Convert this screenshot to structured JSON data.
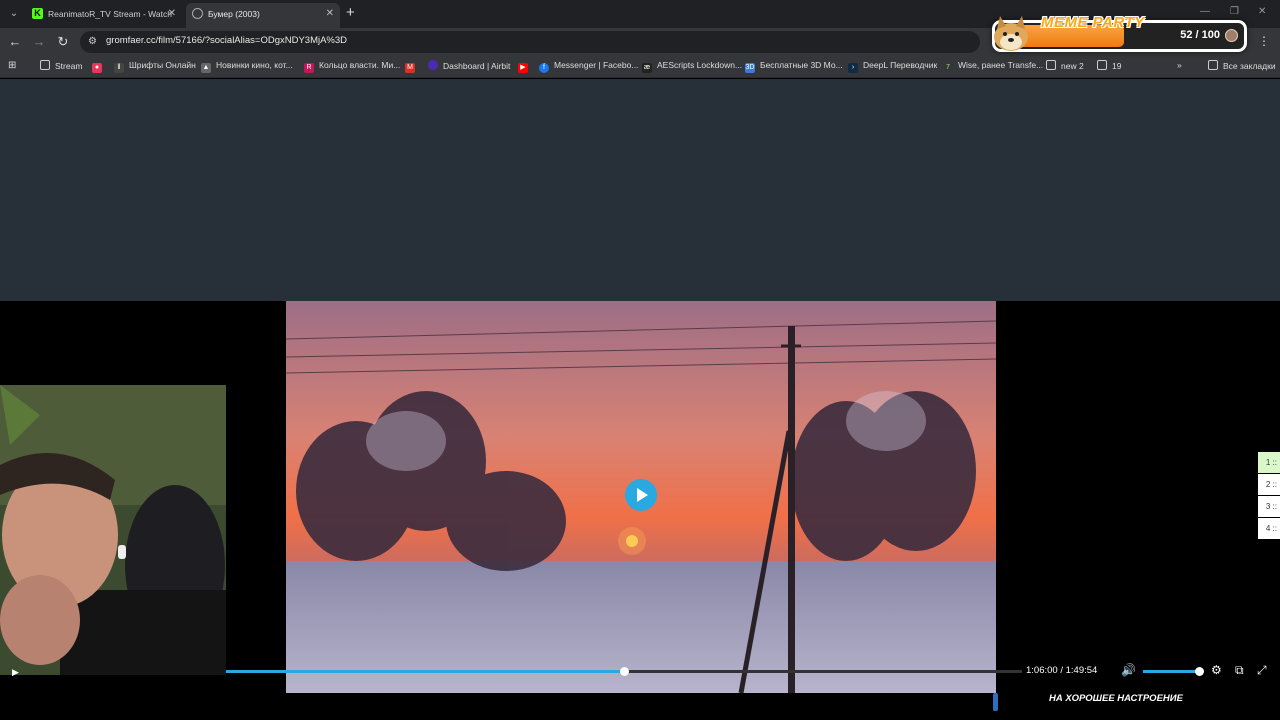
{
  "browser": {
    "tabs": [
      {
        "title": "ReanimatoR_TV Stream - Watch",
        "icon": "kick-icon",
        "active": false
      },
      {
        "title": "Бумер (2003)",
        "icon": "globe-icon",
        "active": true
      }
    ],
    "url": "gromfaer.cc/film/57166/?socialAlias=ODgxNDY3MjA%3D",
    "bookmarks": [
      {
        "label": "Stream",
        "icon": "folder-icon"
      },
      {
        "label": "",
        "icon": "live-icon"
      },
      {
        "label": "Шрифты Онлайн",
        "icon": "font-icon"
      },
      {
        "label": "Новинки кино, кот...",
        "icon": "film-icon"
      },
      {
        "label": "Кольцо власти. Ми...",
        "icon": "r-icon"
      },
      {
        "label": "",
        "icon": "gmail-icon"
      },
      {
        "label": "Dashboard | Airbit",
        "icon": "airbit-icon"
      },
      {
        "label": "",
        "icon": "youtube-icon"
      },
      {
        "label": "Messenger | Facebo...",
        "icon": "facebook-icon"
      },
      {
        "label": "AEScripts Lockdown...",
        "icon": "aescripts-icon"
      },
      {
        "label": "Бесплатные 3D Мо...",
        "icon": "3d-icon"
      },
      {
        "label": "DeepL Переводчик",
        "icon": "deepl-icon"
      },
      {
        "label": "Wise, ранее Transfe...",
        "icon": "wise-icon"
      },
      {
        "label": "new 2",
        "icon": "folder-icon"
      },
      {
        "label": "19",
        "icon": "folder-icon"
      }
    ],
    "overflow": "»",
    "all_bookmarks": "Все закладки"
  },
  "overlay": {
    "title": "MEME PARTY",
    "count": "52 / 100",
    "progress": 0.52
  },
  "player": {
    "current_time": "1:06:00",
    "separator": "/",
    "duration": "1:49:54",
    "progress": 0.5,
    "volume": 1.0
  },
  "side_tabs": [
    "1 ::",
    "2 ::",
    "3 ::",
    "4 ::"
  ],
  "ticker": "НА ХОРОШЕЕ НАСТРОЕНИЕ",
  "colors": {
    "accent": "#2aa8e0",
    "page_bg": "#273038",
    "overlay_orange": "#ee7a14"
  }
}
